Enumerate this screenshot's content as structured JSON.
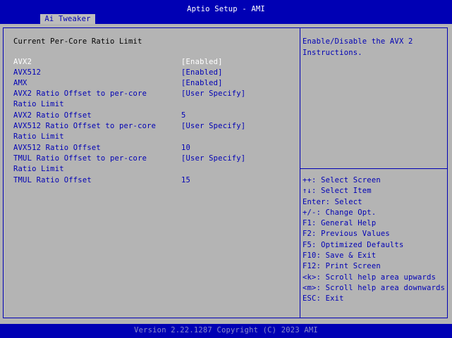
{
  "header": {
    "title": "Aptio Setup - AMI",
    "tab": "Ai Tweaker"
  },
  "main": {
    "section_title": "Current Per-Core Ratio Limit",
    "items": [
      {
        "label": "AVX2",
        "value": "[Enabled]"
      },
      {
        "label": "AVX512",
        "value": "[Enabled]"
      },
      {
        "label": "AMX",
        "value": "[Enabled]"
      },
      {
        "label": "AVX2 Ratio Offset to per-core",
        "value": "[User Specify]"
      },
      {
        "label": "Ratio Limit",
        "value": ""
      },
      {
        "label": "AVX2 Ratio Offset",
        "value": "5"
      },
      {
        "label": "AVX512 Ratio Offset to per-core",
        "value": "[User Specify]"
      },
      {
        "label": "Ratio Limit",
        "value": ""
      },
      {
        "label": "AVX512 Ratio Offset",
        "value": "10"
      },
      {
        "label": "TMUL Ratio Offset to per-core",
        "value": "[User Specify]"
      },
      {
        "label": "Ratio Limit",
        "value": ""
      },
      {
        "label": "TMUL Ratio Offset",
        "value": "15"
      }
    ]
  },
  "help": {
    "line1": "Enable/Disable the AVX 2",
    "line2": "Instructions."
  },
  "keys": [
    "++: Select Screen",
    "↑↓: Select Item",
    "Enter: Select",
    "+/-: Change Opt.",
    "F1: General Help",
    "F2: Previous Values",
    "F5: Optimized Defaults",
    "F10: Save & Exit",
    "F12: Print Screen",
    "<k>: Scroll help area upwards",
    "<m>: Scroll help area downwards",
    "ESC: Exit"
  ],
  "footer": {
    "text": "Version 2.22.1287 Copyright (C) 2023 AMI"
  },
  "colors": {
    "bios_blue": "#0000b4",
    "panel_gray": "#b4b4b4",
    "tab_gray": "#bcbcbc",
    "highlight": "#ffffff"
  }
}
